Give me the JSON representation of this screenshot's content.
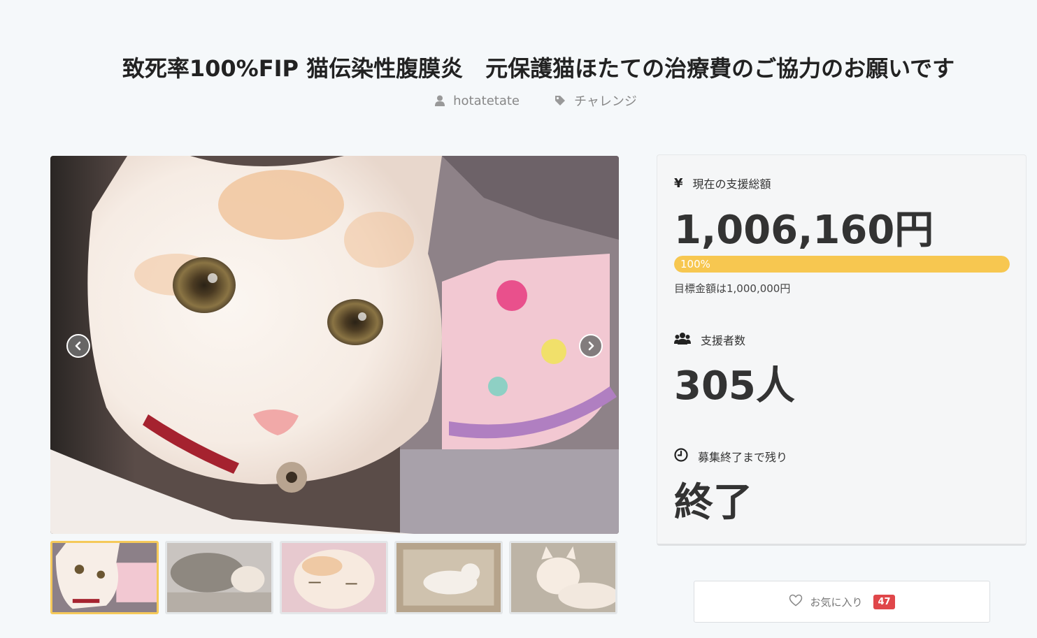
{
  "project": {
    "title": "致死率100%FIP 猫伝染性腹膜炎　元保護猫ほたての治療費のご協力のお願いです",
    "author": "hotatetate",
    "category": "チャレンジ"
  },
  "icons": {
    "author": "user-icon",
    "category": "tag-icon",
    "amount": "yen-icon",
    "supporters": "users-icon",
    "deadline": "clock-icon",
    "favorite": "heart-icon",
    "prev": "chevron-left-icon",
    "next": "chevron-right-icon"
  },
  "stats": {
    "amount_label": "現在の支援総額",
    "amount_value": "1,006,160円",
    "progress_percent": 100,
    "progress_label": "100%",
    "goal_text": "目標金額は1,000,000円",
    "supporters_label": "支援者数",
    "supporters_value": "305人",
    "deadline_label": "募集終了まで残り",
    "deadline_value": "終了"
  },
  "favorite": {
    "label": "お気に入り",
    "count": "47"
  },
  "gallery": {
    "active_index": 0,
    "thumbnail_count": 5
  },
  "colors": {
    "background": "#f5f8fa",
    "progress": "#f7c750",
    "badge": "#e0474a",
    "active_thumb_border": "#f5c95a"
  }
}
